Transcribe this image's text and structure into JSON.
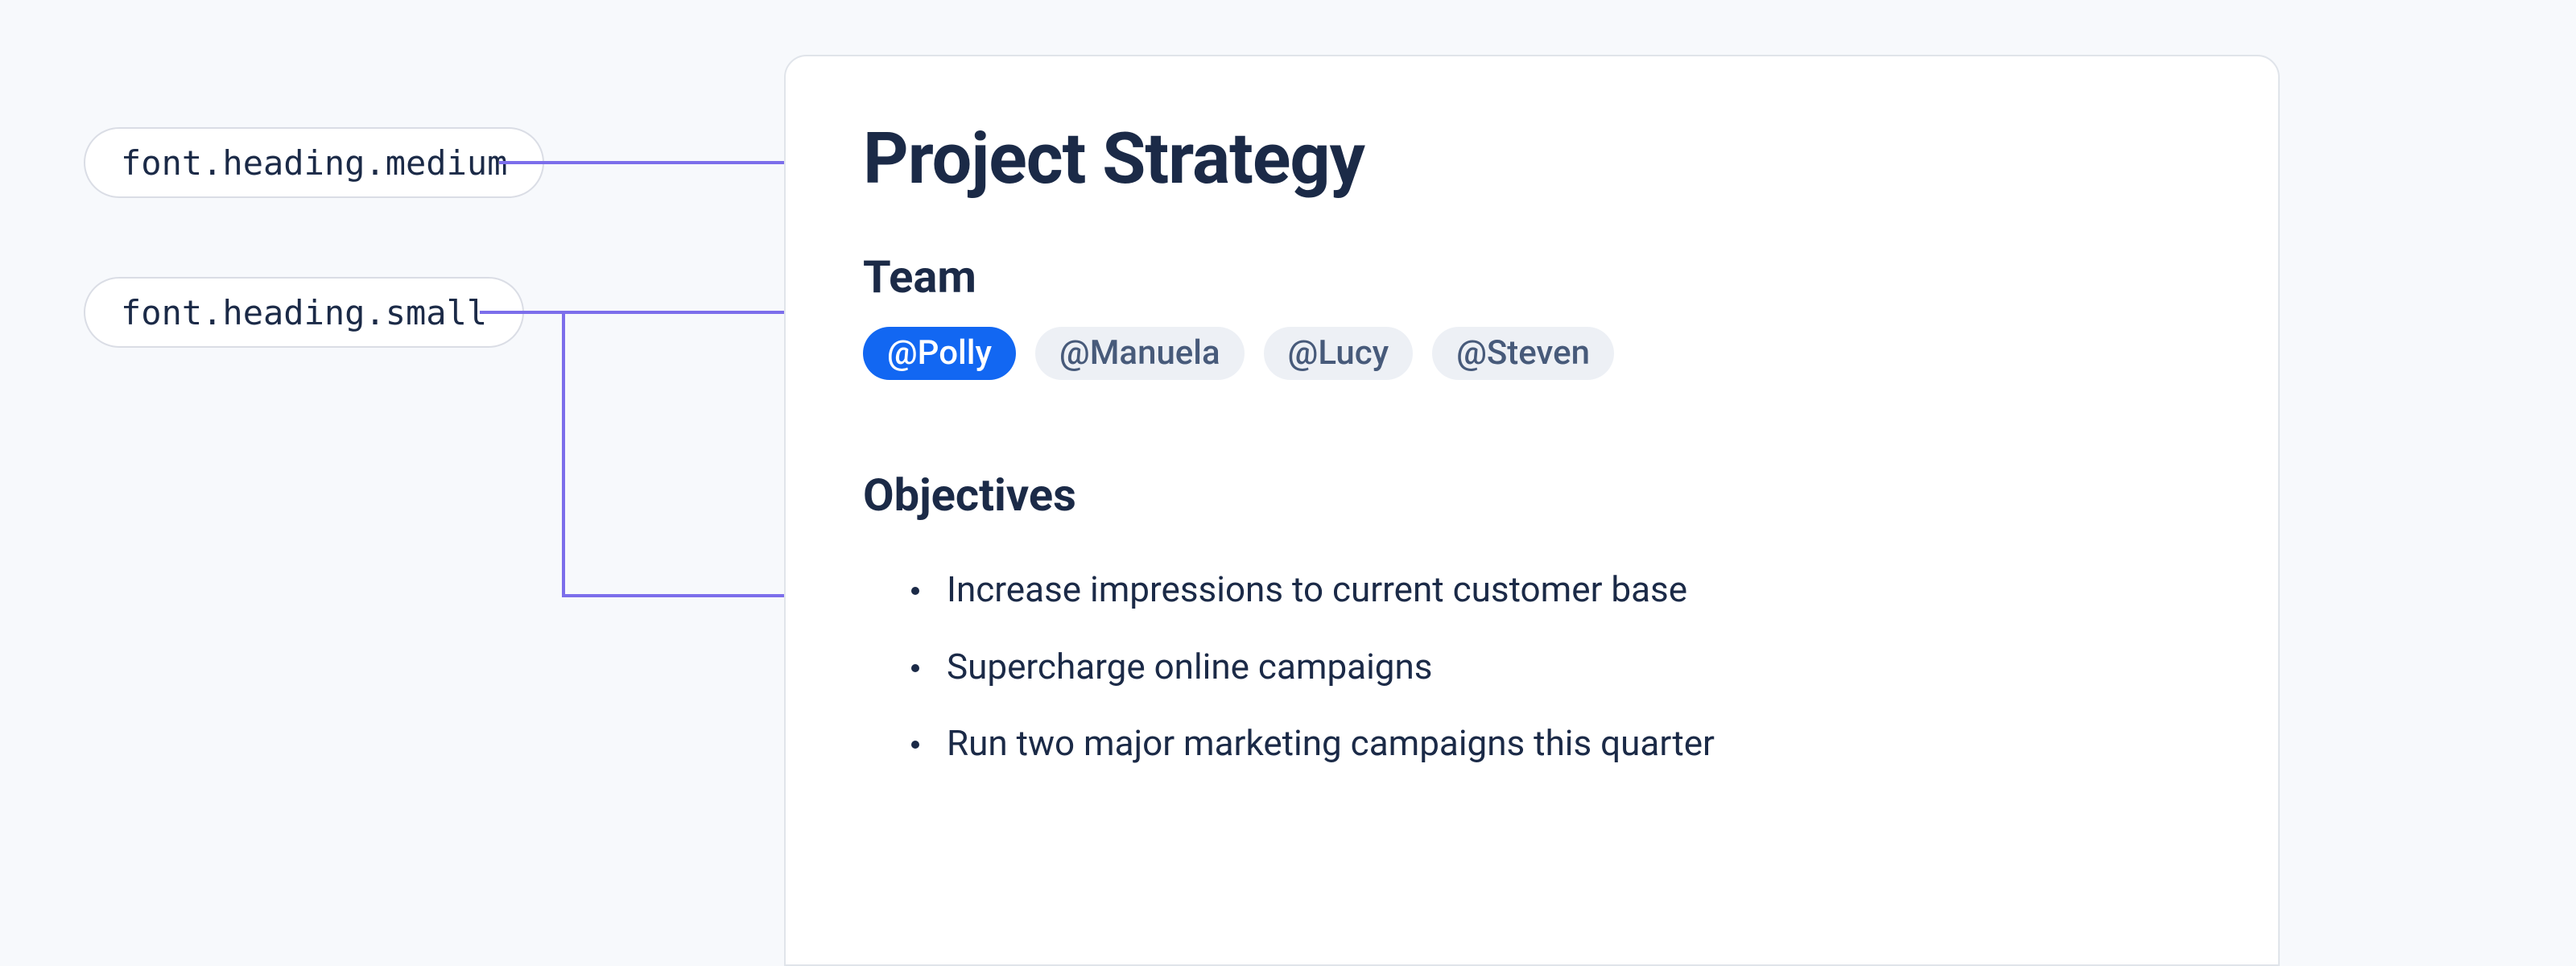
{
  "tokens": {
    "medium": "font.heading.medium",
    "small": "font.heading.small"
  },
  "page": {
    "title": "Project Strategy",
    "team": {
      "heading": "Team",
      "members": [
        "@Polly",
        "@Manuela",
        "@Lucy",
        "@Steven"
      ],
      "active_index": 0
    },
    "objectives": {
      "heading": "Objectives",
      "items": [
        "Increase impressions to current customer base",
        "Supercharge online campaigns",
        "Run two major marketing campaigns this quarter"
      ]
    }
  },
  "colors": {
    "accent_purple": "#7C6EEB",
    "accent_blue": "#1267F2",
    "text": "#1B2A47",
    "chip_bg": "#EDF0F5",
    "page_bg": "#F7F9FC"
  }
}
